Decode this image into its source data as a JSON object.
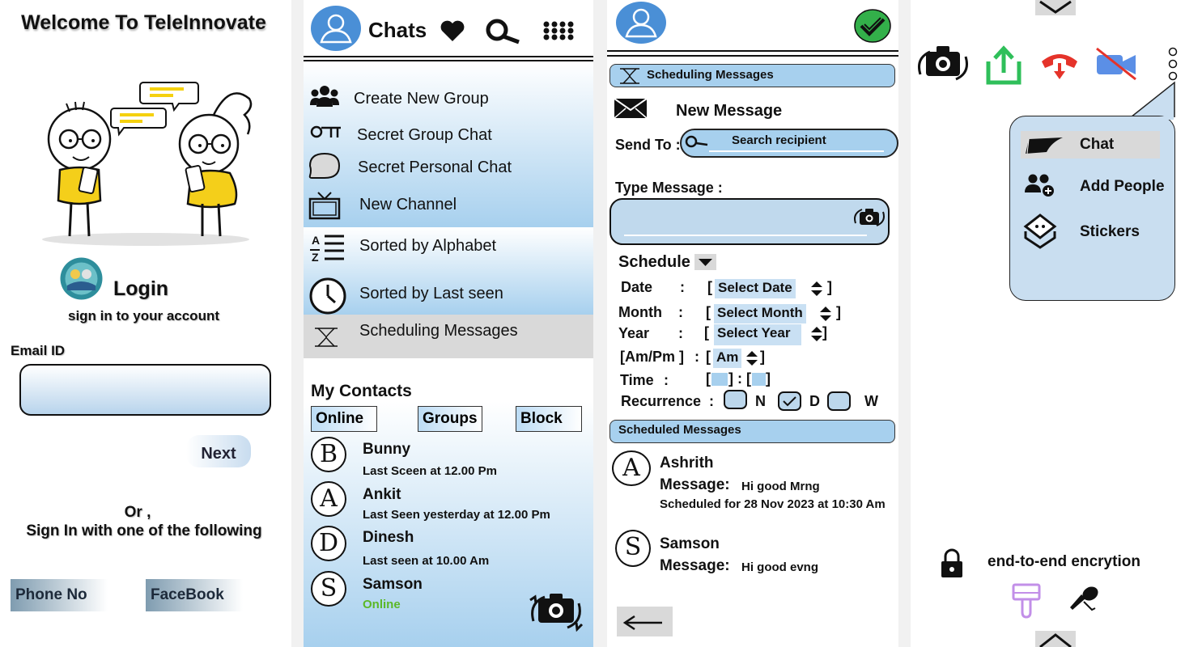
{
  "login": {
    "title": "Welcome To TeleInnovate",
    "heading": "Login",
    "subheading": "sign in to your account",
    "email_label": "Email ID",
    "next_label": "Next",
    "or_text": "Or ,",
    "alt_text": "Sign In with one of the following",
    "phone_label": "Phone No",
    "facebook_label": "FaceBook"
  },
  "chats": {
    "title": "Chats",
    "menu": [
      {
        "label": "Create New Group",
        "icon": "group-icon"
      },
      {
        "label": "Secret Group Chat",
        "icon": "key-icon"
      },
      {
        "label": "Secret Personal Chat",
        "icon": "speech-bubble-icon"
      },
      {
        "label": "New Channel",
        "icon": "tv-icon"
      },
      {
        "label": "Sorted by Alphabet",
        "icon": "alphabet-sort-icon"
      },
      {
        "label": "Sorted by Last seen",
        "icon": "clock-icon"
      },
      {
        "label": "Scheduling Messages",
        "icon": "hourglass-icon"
      }
    ],
    "contacts_heading": "My Contacts",
    "tabs": [
      "Online",
      "Groups",
      "Block"
    ],
    "contacts": [
      {
        "letter": "B",
        "name": "Bunny",
        "status": "Last Sceen  at 12.00 Pm"
      },
      {
        "letter": "A",
        "name": "Ankit",
        "status": "Last Seen yesterday at 12.00 Pm"
      },
      {
        "letter": "D",
        "name": "Dinesh",
        "status": "Last seen at 10.00 Am"
      },
      {
        "letter": "S",
        "name": "Samson",
        "status": "Online"
      }
    ],
    "online_color": "#5bb827"
  },
  "schedule": {
    "header": "Scheduling Messages",
    "new_message": "New Message",
    "send_to_label": "Send To :",
    "search_placeholder": "Search recipient",
    "type_message_label": "Type Message :",
    "schedule_label": "Schedule",
    "date_label": "Date",
    "date_value": "Select  Date",
    "month_label": "Month",
    "month_value": "Select Month",
    "year_label": "Year",
    "year_value": "Select Year",
    "ampm_label": "[Am/Pm ]",
    "ampm_value": "Am",
    "time_label": "Time",
    "recurrence_label": "Recurrence",
    "recurrence_options": [
      "N",
      "D",
      "W"
    ],
    "recurrence_selected": "D",
    "scheduled_header": "Scheduled Messages",
    "message_label": "Message:",
    "scheduled": [
      {
        "letter": "A",
        "name": "Ashrith",
        "message": "Hi good Mrng",
        "when": "Scheduled for 28 Nov 2023 at 10:30 Am"
      },
      {
        "letter": "S",
        "name": "Samson",
        "message": "Hi good evng",
        "when": ""
      }
    ]
  },
  "chat_options": {
    "popup": [
      {
        "label": "Chat",
        "icon": "chat-flag-icon"
      },
      {
        "label": "Add People",
        "icon": "add-people-icon"
      },
      {
        "label": "Stickers",
        "icon": "sticker-icon"
      }
    ],
    "encryption_text": "end-to-end encrytion",
    "colors": {
      "share": "#2fbf5a",
      "end_call": "#e5332a",
      "video": "#5b8fe6",
      "paint": "#c28fe8"
    }
  }
}
